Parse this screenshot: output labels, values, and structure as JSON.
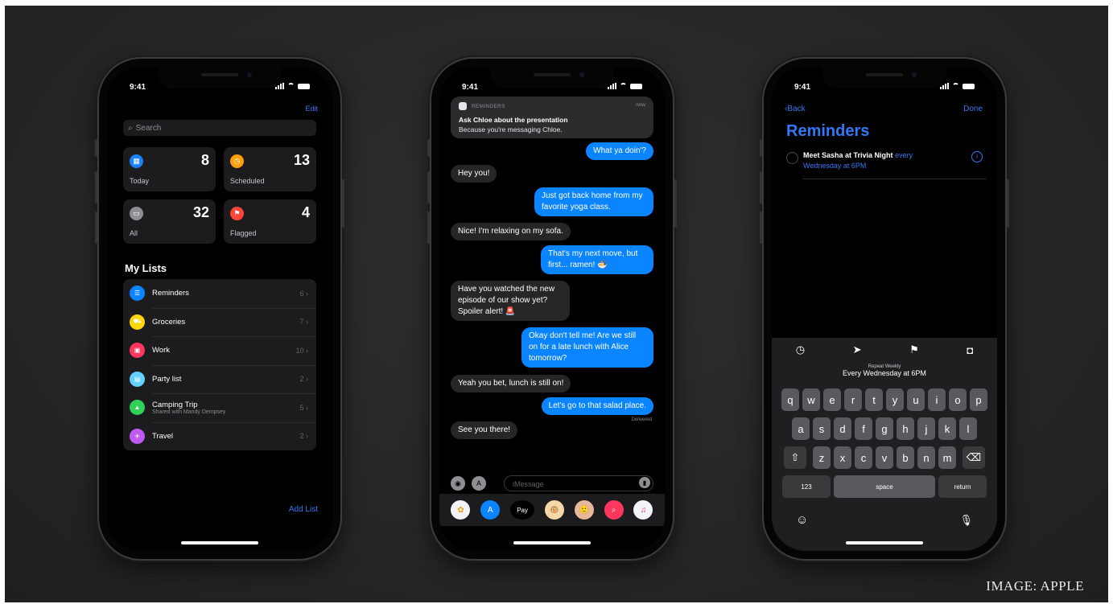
{
  "caption": "IMAGE: APPLE",
  "status": {
    "time": "9:41"
  },
  "reminders_home": {
    "edit": "Edit",
    "search_placeholder": "Search",
    "cards": [
      {
        "label": "Today",
        "count": "8",
        "color": "#1a82fb",
        "icon": "calendar-icon"
      },
      {
        "label": "Scheduled",
        "count": "13",
        "color": "#ff9f0a",
        "icon": "clock-icon"
      },
      {
        "label": "All",
        "count": "32",
        "color": "#8e8e93",
        "icon": "tray-icon"
      },
      {
        "label": "Flagged",
        "count": "4",
        "color": "#ff453a",
        "icon": "flag-icon"
      }
    ],
    "my_lists_title": "My Lists",
    "lists": [
      {
        "name": "Reminders",
        "count": "6",
        "color": "#0a84ff",
        "icon": "list-icon"
      },
      {
        "name": "Groceries",
        "count": "7",
        "color": "#ffd60a",
        "icon": "cart-icon"
      },
      {
        "name": "Work",
        "count": "10",
        "color": "#ff375f",
        "icon": "briefcase-icon"
      },
      {
        "name": "Party list",
        "count": "2",
        "color": "#64d2ff",
        "icon": "gift-icon"
      },
      {
        "name": "Camping Trip",
        "subtitle": "Shared with Mandy Dempsey",
        "count": "5",
        "color": "#30d158",
        "icon": "tent-icon"
      },
      {
        "name": "Travel",
        "count": "2",
        "color": "#bf5af2",
        "icon": "airplane-icon"
      }
    ],
    "add_list": "Add List"
  },
  "messages": {
    "notification": {
      "app": "REMINDERS",
      "time": "now",
      "title": "Ask Chloe about the presentation",
      "body": "Because you're messaging Chloe."
    },
    "bubbles": [
      {
        "text": "What ya doin'?",
        "dir": "out"
      },
      {
        "text": "Hey you!",
        "dir": "in"
      },
      {
        "text": "Just got back home from my favorite yoga class.",
        "dir": "out"
      },
      {
        "text": "Nice! I'm relaxing on my sofa.",
        "dir": "in"
      },
      {
        "text": "That's my next move, but first... ramen! 🍜",
        "dir": "out"
      },
      {
        "text": "Have you watched the new episode of our show yet? Spoiler alert! 🚨",
        "dir": "in"
      },
      {
        "text": "Okay don't tell me! Are we still on for a late lunch with Alice tomorrow?",
        "dir": "out"
      },
      {
        "text": "Yeah you bet, lunch is still on!",
        "dir": "in"
      },
      {
        "text": "Let's go to that salad place.",
        "dir": "out"
      },
      {
        "text": "See you there!",
        "dir": "in"
      }
    ],
    "delivered": "Delivered",
    "message_placeholder": "iMessage",
    "apps": [
      {
        "icon": "photos-icon",
        "color": "#f2f2f7",
        "glyph": "✿"
      },
      {
        "icon": "app-store-icon",
        "color": "#0a84ff",
        "glyph": "A"
      },
      {
        "icon": "apple-pay-icon",
        "color": "#000000",
        "glyph": "Pay"
      },
      {
        "icon": "animoji-icon",
        "color": "#f6d8a8",
        "glyph": "🐵"
      },
      {
        "icon": "memoji-icon",
        "color": "#e6b89c",
        "glyph": "🙂"
      },
      {
        "icon": "search-images-icon",
        "color": "#ff375f",
        "glyph": "🔍"
      },
      {
        "icon": "music-icon",
        "color": "#f2f2f7",
        "glyph": "♫"
      }
    ]
  },
  "reminder_detail": {
    "back": "Back",
    "done": "Done",
    "title": "Reminders",
    "item_bold": "Meet Sasha at Trivia Night",
    "item_blue": "every Wednesday at 6PM",
    "suggest_small": "Repeat Weekly",
    "suggest_main": "Every Wednesday at 6PM",
    "keys_row1": [
      "q",
      "w",
      "e",
      "r",
      "t",
      "y",
      "u",
      "i",
      "o",
      "p"
    ],
    "keys_row2": [
      "a",
      "s",
      "d",
      "f",
      "g",
      "h",
      "j",
      "k",
      "l"
    ],
    "keys_row3": [
      "z",
      "x",
      "c",
      "v",
      "b",
      "n",
      "m"
    ],
    "key_123": "123",
    "key_space": "space",
    "key_return": "return"
  }
}
